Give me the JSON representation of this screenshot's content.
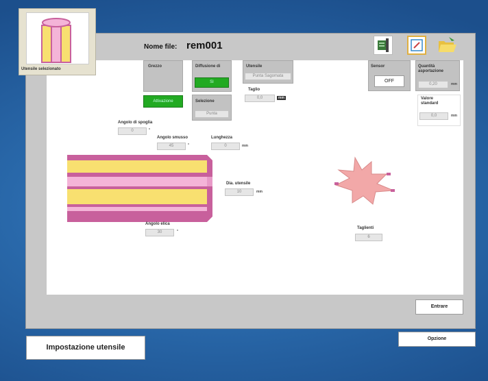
{
  "thumbnail": {
    "label": "Utensile selezionato"
  },
  "header": {
    "file_label": "Nome file:",
    "file_name": "rem001"
  },
  "toolbar": {
    "icons": [
      "tool-settings-icon",
      "edit-icon",
      "folder-open-icon"
    ]
  },
  "groups": {
    "grezzo": {
      "title": "Grezzo",
      "button": "Attivazione"
    },
    "diffusione": {
      "title": "Diffusione di",
      "value": "Sì"
    },
    "selezione": {
      "title": "Selezione",
      "value": "Punta"
    },
    "utensile": {
      "title": "Utensile",
      "value": "Punta Sagomata"
    },
    "taglio": {
      "title": "Taglio",
      "value": "0,0",
      "unit": "mm"
    },
    "sensor": {
      "title": "Sensor",
      "value": "OFF"
    },
    "quantita": {
      "title": "Quantità asportazione",
      "value": "0,20",
      "unit": "mm"
    },
    "valore": {
      "title": "Valore standard",
      "value": "0,0",
      "unit": "mm"
    }
  },
  "params": {
    "angolo_spoglia": {
      "label": "Angolo di spoglia",
      "value": "0",
      "unit": "°"
    },
    "angolo_smusso": {
      "label": "Angolo smusso",
      "value": "45",
      "unit": "°"
    },
    "lunghezza": {
      "label": "Lunghezza",
      "value": "0",
      "unit": "mm"
    },
    "dia_utensile": {
      "label": "Dia. utensile",
      "value": "10",
      "unit": "mm"
    },
    "angolo_elica": {
      "label": "Angolo elica",
      "value": "30",
      "unit": "°"
    },
    "taglienti": {
      "label": "Taglienti",
      "value": "6"
    }
  },
  "buttons": {
    "enter": "Entrare",
    "options": "Opzione",
    "title": "Impostazione utensile"
  },
  "colors": {
    "bar_yellow": "#f8e070",
    "bar_pink": "#f4b4d8",
    "bar_magenta": "#c8609c",
    "star": "#f2a8a8",
    "active_green": "#22aa22"
  }
}
